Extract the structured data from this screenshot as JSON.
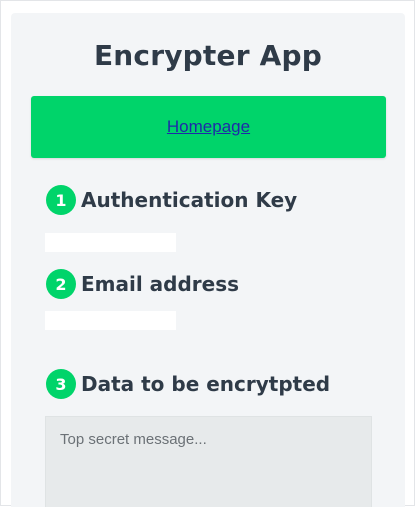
{
  "app": {
    "title": "Encrypter App"
  },
  "nav": {
    "homepage_link": "Homepage"
  },
  "steps": [
    {
      "number": "1",
      "label": "Authentication Key",
      "value": ""
    },
    {
      "number": "2",
      "label": "Email address",
      "value": ""
    },
    {
      "number": "3",
      "label": "Data to be encrytpted",
      "value": "",
      "placeholder": "Top secret message..."
    }
  ],
  "colors": {
    "accent": "#00d46a",
    "text": "#2f3b48",
    "panel": "#f3f5f7",
    "link": "#1e2aa8"
  }
}
